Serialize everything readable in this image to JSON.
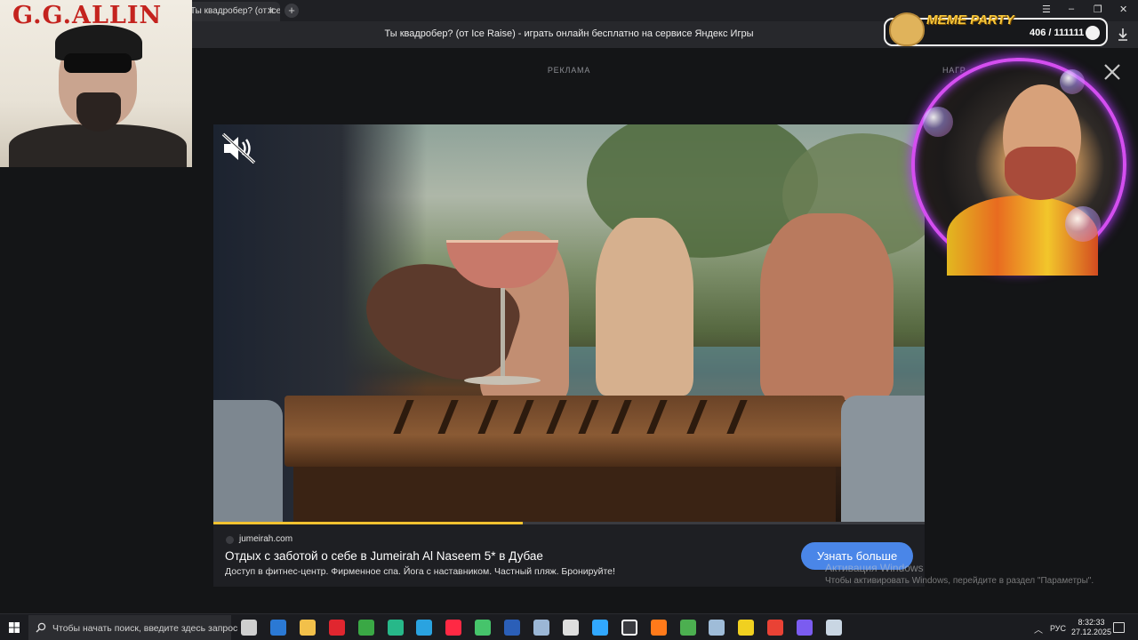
{
  "browser": {
    "tab_title": "Ты квадробер? (от Ice Raise)",
    "tab_close": "✕",
    "new_tab": "+",
    "page_title": "Ты квадробер? (от Ice Raise) - играть онлайн бесплатно на сервисе Яндекс Игры"
  },
  "ad": {
    "label": "РЕКЛАМА",
    "reward_label": "НАГР",
    "progress_fraction": 0.435,
    "domain": "jumeirah.com",
    "title": "Отдых с заботой о себе в Jumeirah Al Naseem 5* в Дубае",
    "description": "Доступ в фитнес-центр. Фирменное спа. Йога с наставником. Частный пляж. Бронируйте!",
    "cta": "Узнать больше"
  },
  "windows_activation": {
    "line1": "Активация Windows",
    "line2": "Чтобы активировать Windows, перейдите в раздел \"Параметры\"."
  },
  "overlay": {
    "poster_title": "G.G.ALLIN",
    "meme_title": "MEME PARTY",
    "meme_count": "406 / 111111"
  },
  "taskbar": {
    "search_placeholder": "Чтобы начать поиск, введите здесь запрос",
    "language": "РУС",
    "time": "8:32:33",
    "date": "27.12.2025",
    "apps": [
      {
        "name": "task-view-icon",
        "color": "#cfcfcf"
      },
      {
        "name": "outlook-icon",
        "color": "#2b79d4"
      },
      {
        "name": "file-explorer-icon",
        "color": "#f2c04a"
      },
      {
        "name": "opera-icon",
        "color": "#e0262f"
      },
      {
        "name": "app-green-red-icon",
        "color": "#3aa845"
      },
      {
        "name": "app-z-icon",
        "color": "#27b889"
      },
      {
        "name": "telegram-icon",
        "color": "#2aa3e0"
      },
      {
        "name": "opera-gx-icon",
        "color": "#ff2944"
      },
      {
        "name": "app-play-icon",
        "color": "#46c46b"
      },
      {
        "name": "word-icon",
        "color": "#2b5fb8"
      },
      {
        "name": "app-feather-icon",
        "color": "#9bb7d6"
      },
      {
        "name": "app-clock-icon",
        "color": "#dedede"
      },
      {
        "name": "photoshop-icon",
        "color": "#31a8ff"
      },
      {
        "name": "yandex-browser-icon",
        "color": "#ffffff"
      },
      {
        "name": "firefox-icon",
        "color": "#ff7a1a"
      },
      {
        "name": "chrome-icon",
        "color": "#4caf50"
      },
      {
        "name": "steam-icon",
        "color": "#9fbcd8"
      },
      {
        "name": "app-yellow-icon",
        "color": "#f0d020"
      },
      {
        "name": "chrome-2-icon",
        "color": "#e94235"
      },
      {
        "name": "app-discord-icon",
        "color": "#7b5cf0"
      },
      {
        "name": "app-tool-icon",
        "color": "#c9d6e3"
      }
    ]
  }
}
